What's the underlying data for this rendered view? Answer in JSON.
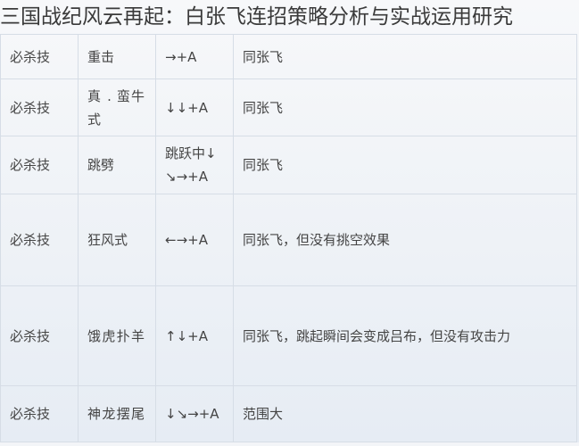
{
  "title": "三国战纪风云再起：白张飞连招策略分析与实战运用研究",
  "table": {
    "rows": [
      {
        "type": "必杀技",
        "move": "重击",
        "input": "→+A",
        "note": "同张飞"
      },
      {
        "type": "必杀技",
        "move": "真 . 蛮牛式",
        "input": "↓↓+A",
        "note": "同张飞"
      },
      {
        "type": "必杀技",
        "move": "跳劈",
        "input": "跳跃中↓↘→+A",
        "note": "同张飞"
      },
      {
        "type": "必杀技",
        "move": "狂风式",
        "input": "←→+A",
        "note": "同张飞，但没有挑空效果"
      },
      {
        "type": "必杀技",
        "move": "饿虎扑羊",
        "input": "↑↓+A",
        "note": "同张飞，跳起瞬间会变成吕布，但没有攻击力"
      },
      {
        "type": "必杀技",
        "move": "神龙摆尾",
        "input": "↓↘→+A",
        "note": "范围大"
      }
    ]
  }
}
